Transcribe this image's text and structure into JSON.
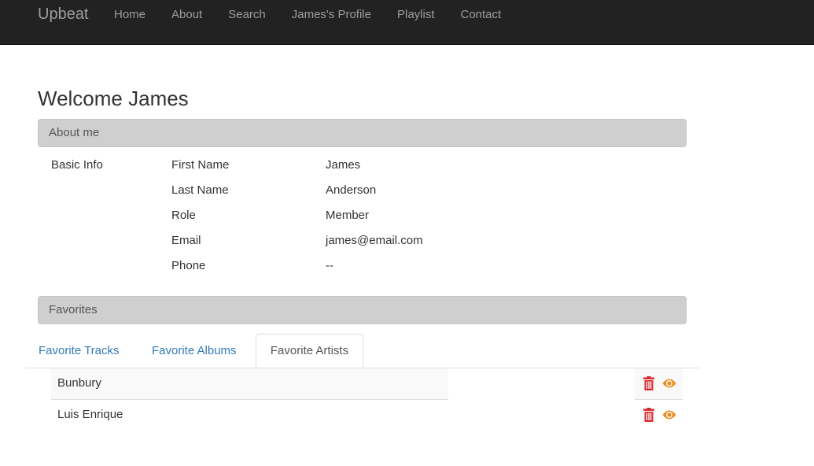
{
  "navbar": {
    "brand": "Upbeat",
    "links": [
      "Home",
      "About",
      "Search",
      "James's Profile",
      "Playlist",
      "Contact"
    ]
  },
  "page": {
    "title": "Welcome James"
  },
  "about": {
    "heading": "About me",
    "section_label": "Basic Info",
    "fields": [
      {
        "label": "First Name",
        "value": "James"
      },
      {
        "label": "Last Name",
        "value": "Anderson"
      },
      {
        "label": "Role",
        "value": "Member"
      },
      {
        "label": "Email",
        "value": "james@email.com"
      },
      {
        "label": "Phone",
        "value": "--"
      }
    ]
  },
  "favorites": {
    "heading": "Favorites",
    "tabs": [
      "Favorite Tracks",
      "Favorite Albums",
      "Favorite Artists"
    ],
    "active_tab": "Favorite Artists",
    "artists": [
      "Bunbury",
      "Luis Enrique"
    ]
  },
  "icons": {
    "delete": "trash-icon",
    "view": "eye-icon"
  },
  "colors": {
    "navbar_bg": "#222222",
    "nav_text": "#9d9d9d",
    "panel_heading_bg": "#cfcfcf",
    "link": "#337ab7",
    "delete_icon": "#d9262b",
    "view_icon": "#ec8b1a"
  }
}
